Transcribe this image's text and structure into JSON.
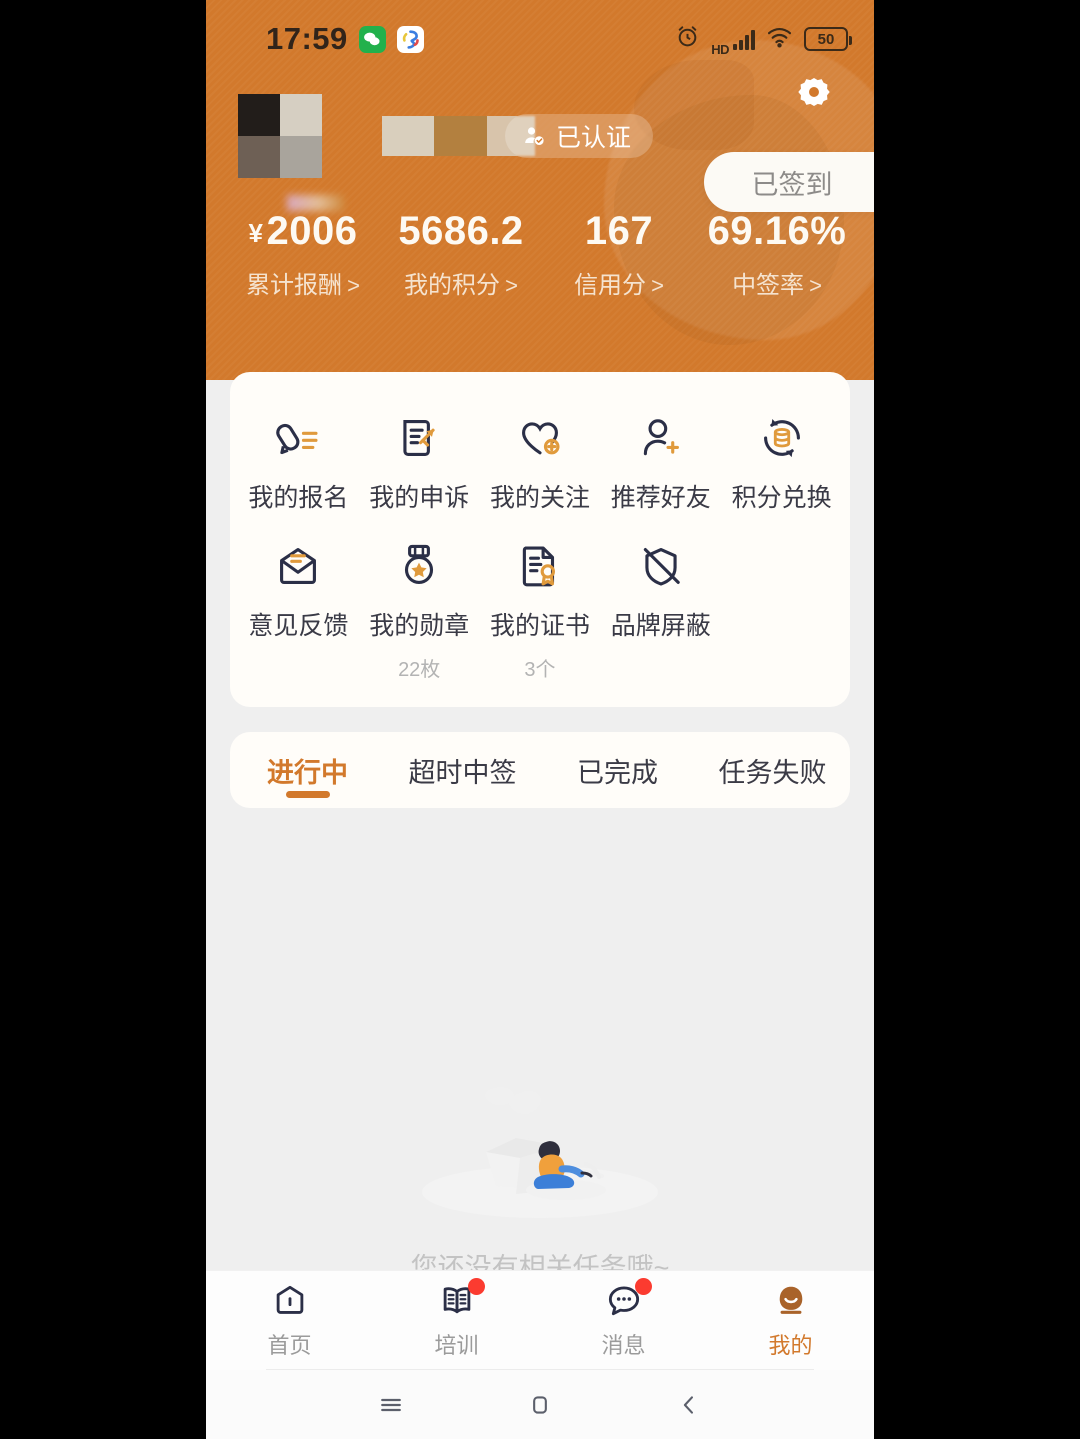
{
  "statusbar": {
    "time": "17:59",
    "wechat_icon": "wechat-icon",
    "app_icon": "multi-color-app-icon",
    "alarm_icon": "alarm-clock-icon",
    "hd_label": "HD",
    "signal_icon": "signal-bars-icon",
    "wifi_icon": "wifi-icon",
    "battery_level": "50"
  },
  "header": {
    "settings_icon": "gear-icon",
    "bg_color": "#d2792c",
    "avatar_colors": [
      "#221d1a",
      "#d6cfc2",
      "#6e6055",
      "#a9a49c"
    ],
    "name_blur_colors": [
      "#d9cfbd",
      "#b3803f",
      "#d8c4ab"
    ],
    "verified_label": "已认证",
    "verified_icon": "person-check-icon",
    "checkin_label": "已签到"
  },
  "stats": [
    {
      "value": "2006",
      "currency": "¥",
      "label": "累计报酬",
      "arrow": ">"
    },
    {
      "value": "5686.2",
      "currency": "",
      "label": "我的积分",
      "arrow": ">"
    },
    {
      "value": "167",
      "currency": "",
      "label": "信用分",
      "arrow": ">"
    },
    {
      "value": "69.16%",
      "currency": "",
      "label": "中签率",
      "arrow": ">"
    }
  ],
  "menu": {
    "row1": [
      {
        "label": "我的报名",
        "icon": "pencil-lines-icon",
        "sub": ""
      },
      {
        "label": "我的申诉",
        "icon": "document-appeal-icon",
        "sub": ""
      },
      {
        "label": "我的关注",
        "icon": "heart-plus-icon",
        "sub": ""
      },
      {
        "label": "推荐好友",
        "icon": "person-plus-icon",
        "sub": ""
      },
      {
        "label": "积分兑换",
        "icon": "coins-exchange-icon",
        "sub": ""
      }
    ],
    "row2": [
      {
        "label": "意见反馈",
        "icon": "envelope-feedback-icon",
        "sub": ""
      },
      {
        "label": "我的勋章",
        "icon": "medal-star-icon",
        "sub": "22枚"
      },
      {
        "label": "我的证书",
        "icon": "certificate-icon",
        "sub": "3个"
      },
      {
        "label": "品牌屏蔽",
        "icon": "shield-block-icon",
        "sub": ""
      }
    ]
  },
  "tabs": [
    {
      "label": "进行中",
      "active": true
    },
    {
      "label": "超时中签",
      "active": false
    },
    {
      "label": "已完成",
      "active": false
    },
    {
      "label": "任务失败",
      "active": false
    }
  ],
  "empty_state": {
    "text": "您还没有相关任务哦~",
    "illustration": "person-sitting-by-open-box-illustration"
  },
  "bottomnav": [
    {
      "label": "首页",
      "icon": "home-icon",
      "badge": false,
      "active": false
    },
    {
      "label": "培训",
      "icon": "book-icon",
      "badge": true,
      "active": false
    },
    {
      "label": "消息",
      "icon": "chat-bubble-icon",
      "badge": true,
      "active": false
    },
    {
      "label": "我的",
      "icon": "profile-avatar-icon",
      "badge": false,
      "active": true
    }
  ],
  "androidbar": [
    {
      "icon": "recents-menu-icon"
    },
    {
      "icon": "home-square-icon"
    },
    {
      "icon": "back-chevron-icon"
    }
  ],
  "colors": {
    "accent": "#d2792c",
    "icon_dark": "#2b2f47",
    "icon_accent": "#e09a3c",
    "page_bg": "#efefef"
  }
}
